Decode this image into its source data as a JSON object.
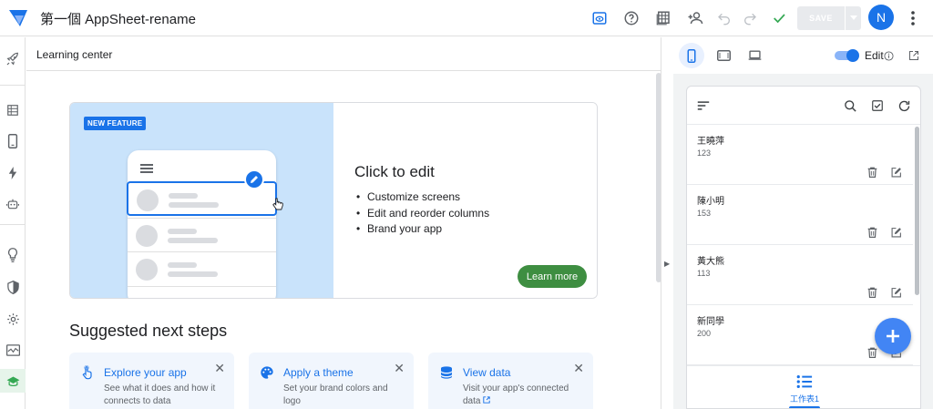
{
  "app": {
    "title": "第一個 AppSheet-rename",
    "save_label": "SAVE",
    "avatar_initial": "N"
  },
  "colors": {
    "accent": "#1a73e8",
    "learn_more": "#3e8e41",
    "feature_bg": "#c9e3fb"
  },
  "main": {
    "header": "Learning center",
    "feature": {
      "badge": "NEW FEATURE",
      "title": "Click to edit",
      "bullets": [
        "Customize screens",
        "Edit and reorder columns",
        "Brand your app"
      ],
      "cta": "Learn more"
    },
    "suggested_title": "Suggested next steps",
    "steps": [
      {
        "title": "Explore your app",
        "desc": "See what it does and how it connects to data",
        "icon": "pointer-hand-icon"
      },
      {
        "title": "Apply a theme",
        "desc": "Set your brand colors and logo",
        "icon": "palette-icon"
      },
      {
        "title": "View data",
        "desc": "Visit your app's connected data",
        "icon": "database-icon"
      }
    ]
  },
  "preview": {
    "edit_label": "Edit",
    "rows": [
      {
        "name": "王曉萍",
        "value": "123"
      },
      {
        "name": "陳小明",
        "value": "153"
      },
      {
        "name": "黃大熊",
        "value": "113"
      },
      {
        "name": "新同學",
        "value": "200"
      }
    ],
    "nav_label": "工作表1"
  }
}
